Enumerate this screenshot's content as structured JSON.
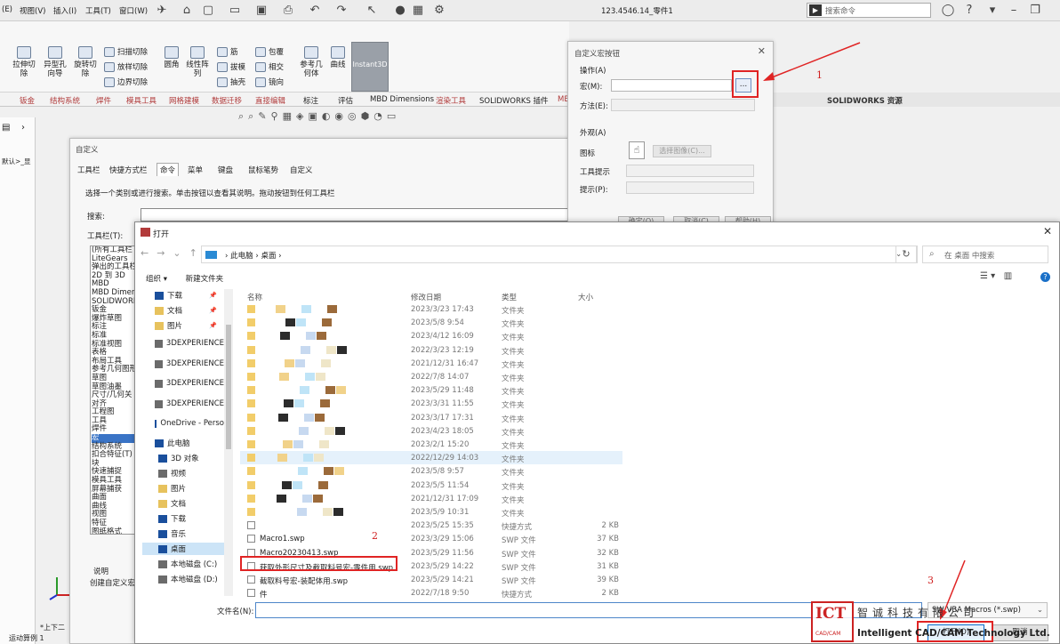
{
  "menubar": {
    "items": [
      "(E)",
      "视图(V)",
      "插入(I)",
      "工具(T)",
      "窗口(W)"
    ],
    "doc_title": "123.4546.14_零件1",
    "search_placeholder": "搜索命令"
  },
  "ribbon": {
    "big_buttons": [
      "拉伸切除",
      "异型孔向导",
      "旋转切除",
      "圆角",
      "线性阵列",
      "参考几何体",
      "曲线"
    ],
    "small_buttons": [
      "扫描切除",
      "放样切除",
      "边界切除",
      "筋",
      "拔模",
      "抽壳",
      "包覆",
      "相交",
      "镜向"
    ],
    "instant3d": "Instant3D"
  },
  "tabs": [
    "钣金",
    "结构系统",
    "焊件",
    "模具工具",
    "网格建模",
    "数据迁移",
    "直接编辑",
    "标注",
    "评估",
    "MBD Dimensions",
    "渲染工具",
    "SOLIDWORKS 插件",
    "MB"
  ],
  "sw_resource": "SOLIDWORKS 资源",
  "fm_panel": {
    "tree_label": "默认>_显"
  },
  "customize": {
    "title": "自定义",
    "tabs": [
      "工具栏",
      "快捷方式栏",
      "命令",
      "菜单",
      "键盘",
      "鼠标笔势",
      "自定义"
    ],
    "active_tab": "命令",
    "description": "选择一个类别或进行搜索。单击按钮以查看其说明。拖动按钮到任何工具栏",
    "search_label": "搜索:",
    "toolbar_label": "工具栏(T):",
    "categories": [
      "(所有工具栏",
      "LiteGears",
      "弹出的工具栏",
      "2D 到 3D",
      "MBD",
      "MBD Dimensi",
      "SOLIDWORKS",
      "钣金",
      "爆炸草图",
      "标注",
      "标准",
      "标准视图",
      "表格",
      "布局工具",
      "参考几何图形",
      "草图",
      "草图油墨",
      "尺寸/几何关",
      "对齐",
      "工程图",
      "工具",
      "焊件",
      "宏",
      "结构系统",
      "扣合特征(T)",
      "块",
      "快速捕捉",
      "模具工具",
      "屏幕捕获",
      "曲面",
      "曲线",
      "视图",
      "特征",
      "图纸格式",
      "线型"
    ],
    "selected_category": "宏",
    "explanation_label": "说明",
    "explanation_text": "创建自定义宏"
  },
  "macro_dialog": {
    "title": "自定义宏按钮",
    "action_group": "操作(A)",
    "macro_label": "宏(M):",
    "macro_value": "",
    "browse_label": "...",
    "method_label": "方法(E):",
    "appearance_group": "外观(A)",
    "icon_label": "图标",
    "choose_image": "选择图像(C)...",
    "tooltip_label": "工具提示",
    "prompt_label": "提示(P):",
    "ok": "确定(O)",
    "cancel": "取消(C)",
    "help": "帮助(H)"
  },
  "open_dialog": {
    "title": "打开",
    "address": [
      "此电脑",
      "桌面"
    ],
    "search_placeholder": "在 桌面 中搜索",
    "organize": "组织 ▾",
    "new_folder": "新建文件夹",
    "nav_items": [
      {
        "label": "下载",
        "pin": true
      },
      {
        "label": "文档",
        "pin": true
      },
      {
        "label": "图片",
        "pin": true
      },
      {
        "label": "3DEXPERIENCE"
      },
      {
        "label": "3DEXPERIENCE"
      },
      {
        "label": "3DEXPERIENCE"
      },
      {
        "label": "3DEXPERIENCE"
      },
      {
        "label": "OneDrive - Perso"
      },
      {
        "label": "此电脑"
      },
      {
        "label": "3D 对象"
      },
      {
        "label": "视频"
      },
      {
        "label": "图片"
      },
      {
        "label": "文档"
      },
      {
        "label": "下载"
      },
      {
        "label": "音乐"
      },
      {
        "label": "桌面",
        "selected": true
      },
      {
        "label": "本地磁盘 (C:)"
      },
      {
        "label": "本地磁盘 (D:)"
      }
    ],
    "columns": [
      "名称",
      "修改日期",
      "类型",
      "大小"
    ],
    "files": [
      {
        "name": "",
        "date": "2023/3/23 17:43",
        "type": "文件夹",
        "size": ""
      },
      {
        "name": "",
        "date": "2023/5/8 9:54",
        "type": "文件夹",
        "size": ""
      },
      {
        "name": "",
        "date": "2023/4/12 16:09",
        "type": "文件夹",
        "size": ""
      },
      {
        "name": "",
        "date": "2022/3/23 12:19",
        "type": "文件夹",
        "size": ""
      },
      {
        "name": "",
        "date": "2021/12/31 16:47",
        "type": "文件夹",
        "size": ""
      },
      {
        "name": "",
        "date": "2022/7/8 14:07",
        "type": "文件夹",
        "size": ""
      },
      {
        "name": "",
        "date": "2023/5/29 11:48",
        "type": "文件夹",
        "size": ""
      },
      {
        "name": "",
        "date": "2023/3/31 11:55",
        "type": "文件夹",
        "size": ""
      },
      {
        "name": "",
        "date": "2023/3/17 17:31",
        "type": "文件夹",
        "size": ""
      },
      {
        "name": "",
        "date": "2023/4/23 18:05",
        "type": "文件夹",
        "size": ""
      },
      {
        "name": "",
        "date": "2023/2/1 15:20",
        "type": "文件夹",
        "size": ""
      },
      {
        "name": "",
        "date": "2022/12/29 14:03",
        "type": "文件夹",
        "size": ""
      },
      {
        "name": "",
        "date": "2023/5/8 9:57",
        "type": "文件夹",
        "size": ""
      },
      {
        "name": "",
        "date": "2023/5/5 11:54",
        "type": "文件夹",
        "size": ""
      },
      {
        "name": "",
        "date": "2021/12/31 17:09",
        "type": "文件夹",
        "size": ""
      },
      {
        "name": "",
        "date": "2023/5/9 10:31",
        "type": "文件夹",
        "size": ""
      },
      {
        "name": "",
        "date": "2023/5/25 15:35",
        "type": "快捷方式",
        "size": "2 KB"
      },
      {
        "name": "Macro1.swp",
        "date": "2023/3/29 15:06",
        "type": "SWP 文件",
        "size": "37 KB"
      },
      {
        "name": "Macro20230413.swp",
        "date": "2023/5/29 11:56",
        "type": "SWP 文件",
        "size": "32 KB"
      },
      {
        "name": "获取外形尺寸及截取料号宏-零件用.swp",
        "date": "2023/5/29 14:22",
        "type": "SWP 文件",
        "size": "31 KB"
      },
      {
        "name": "截取料号宏-装配体用.swp",
        "date": "2023/5/29 14:21",
        "type": "SWP 文件",
        "size": "39 KB"
      },
      {
        "name": "件",
        "date": "2022/7/18 9:50",
        "type": "快捷方式",
        "size": "2 KB"
      }
    ],
    "filename_label": "文件名(N):",
    "filename_value": "",
    "filetype": "SW VBA Macros (*.swp)",
    "open_btn": "打开(O)",
    "cancel_btn": "取消"
  },
  "annotations": {
    "n1": "1",
    "n2": "2",
    "n3": "3"
  },
  "watermark": {
    "logo": "ICT",
    "logo_sub": "CAD/CAM",
    "cn": "智诚科技有限公司",
    "en": "Intelligent CAD/CAM Technology Ltd."
  },
  "status": {
    "view": "*上下二",
    "tab": "运动算例 1"
  },
  "colors": {
    "accent": "#2a8ad4",
    "annotation": "#e02424",
    "ribbon_tab": "#b03a3a"
  }
}
